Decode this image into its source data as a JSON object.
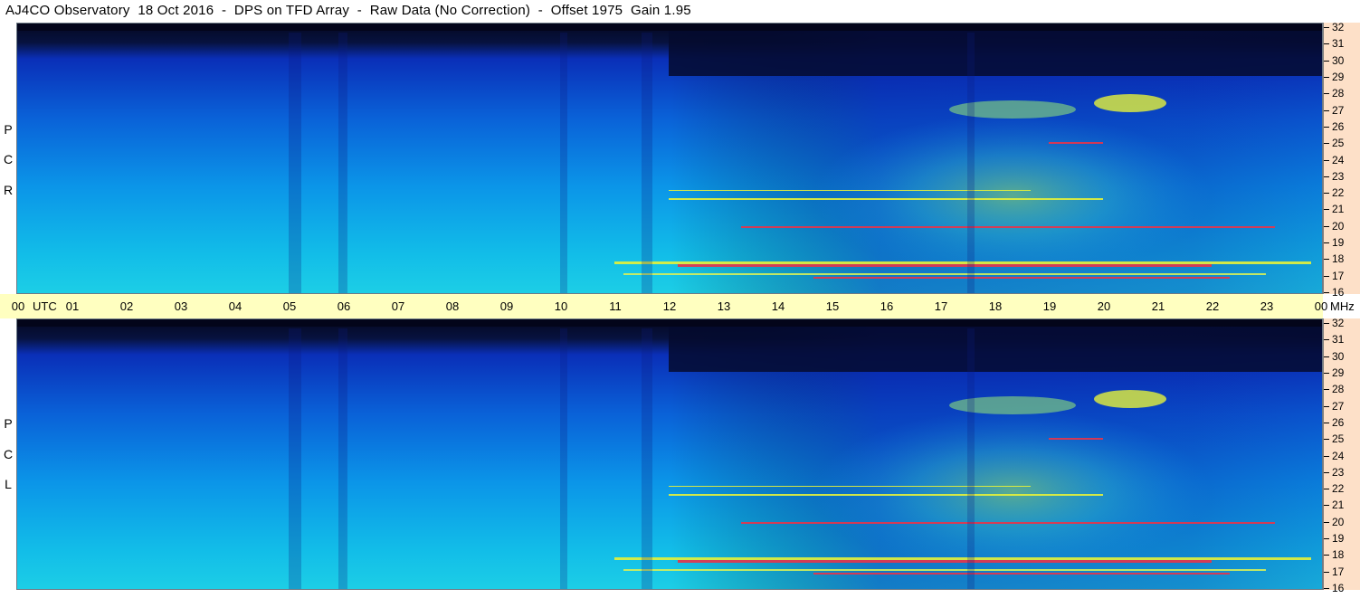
{
  "title": "AJ4CO Observatory  18 Oct 2016  -  DPS on TFD Array  -  Raw Data (No Correction)  -  Offset 1975  Gain 1.95",
  "panels": [
    {
      "id": "rcp",
      "label_letters": [
        "R",
        "C",
        "P"
      ]
    },
    {
      "id": "lcp",
      "label_letters": [
        "L",
        "C",
        "P"
      ]
    }
  ],
  "time_axis": {
    "start_label": "00",
    "unit_label": "UTC",
    "hour_labels": [
      "01",
      "02",
      "03",
      "04",
      "05",
      "06",
      "07",
      "08",
      "09",
      "10",
      "11",
      "12",
      "13",
      "14",
      "15",
      "16",
      "17",
      "18",
      "19",
      "20",
      "21",
      "22",
      "23"
    ],
    "end_label": "00",
    "freq_unit_label": "MHz"
  },
  "freq_axis": {
    "ticks": [
      "32",
      "31",
      "30",
      "29",
      "28",
      "27",
      "26",
      "25",
      "24",
      "23",
      "22",
      "21",
      "20",
      "19",
      "18",
      "17",
      "16"
    ]
  },
  "colors": {
    "background_dark": "#060a22",
    "low_intensity": "#0a2fc0",
    "mid_intensity": "#0a8fe8",
    "high_intensity": "#19d2e6",
    "burst_yellow": "#e6f23a",
    "burst_red": "#e8344a",
    "time_bar": "#ffffc0",
    "freq_strip": "#fde0c8"
  },
  "chart_data": {
    "type": "heatmap",
    "title": "AJ4CO Observatory  18 Oct 2016  -  DPS on TFD Array  -  Raw Data (No Correction)  -  Offset 1975  Gain 1.95",
    "xlabel": "UTC",
    "ylabel": "MHz",
    "x_range": [
      0,
      24
    ],
    "y_range": [
      16,
      32
    ],
    "series": [
      {
        "name": "RCP"
      },
      {
        "name": "LCP"
      }
    ],
    "grid": false
  }
}
